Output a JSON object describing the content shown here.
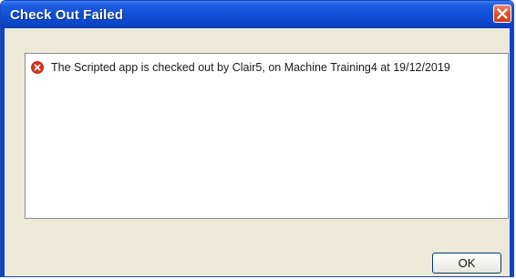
{
  "window": {
    "title": "Check Out Failed",
    "close_icon": "close-icon"
  },
  "message": {
    "icon": "error-icon",
    "text": "The Scripted app is checked out by Clair5, on Machine Training4 at 19/12/2019"
  },
  "buttons": {
    "ok_label": "OK"
  },
  "colors": {
    "titlebar": "#0f4fd6",
    "close_button": "#d9532e",
    "error_icon": "#d8331f",
    "dialog_background": "#ece9d8"
  }
}
